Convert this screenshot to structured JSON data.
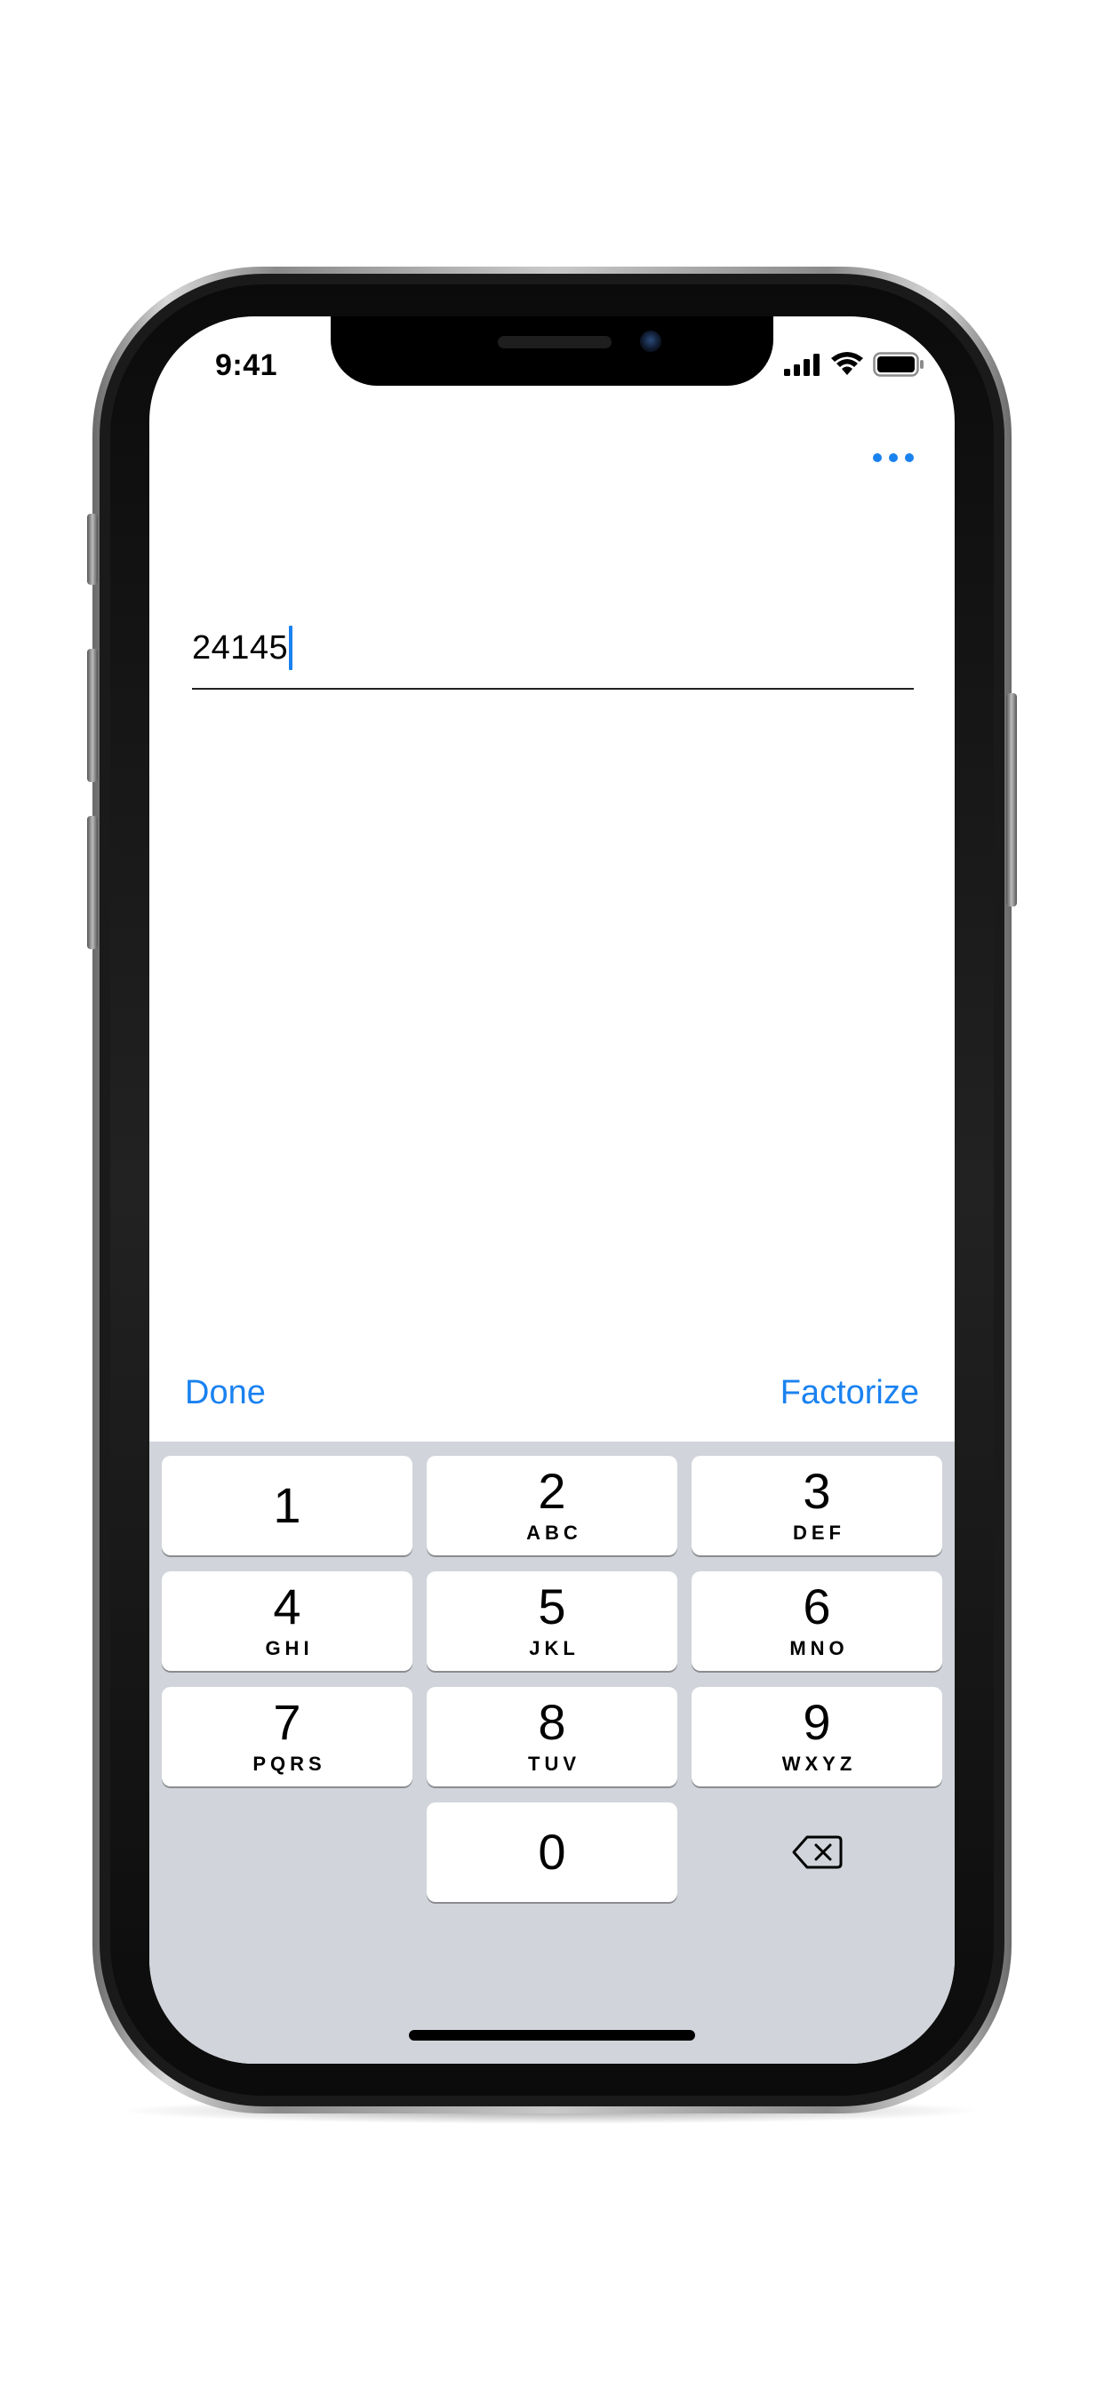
{
  "status_bar": {
    "time": "9:41",
    "icons": [
      "cellular-signal-icon",
      "wifi-icon",
      "battery-icon"
    ]
  },
  "toolbar": {
    "more_icon": "ellipsis-icon"
  },
  "input": {
    "value": "24145"
  },
  "accessory": {
    "done_label": "Done",
    "factorize_label": "Factorize"
  },
  "keypad": {
    "keys": [
      {
        "digit": "1",
        "letters": ""
      },
      {
        "digit": "2",
        "letters": "ABC"
      },
      {
        "digit": "3",
        "letters": "DEF"
      },
      {
        "digit": "4",
        "letters": "GHI"
      },
      {
        "digit": "5",
        "letters": "JKL"
      },
      {
        "digit": "6",
        "letters": "MNO"
      },
      {
        "digit": "7",
        "letters": "PQRS"
      },
      {
        "digit": "8",
        "letters": "TUV"
      },
      {
        "digit": "9",
        "letters": "WXYZ"
      },
      {
        "digit": "0",
        "letters": ""
      }
    ],
    "delete_icon": "backspace-icon"
  },
  "colors": {
    "accent": "#1a82f0",
    "keyboard_bg": "#d1d4da",
    "key_bg": "#ffffff"
  }
}
